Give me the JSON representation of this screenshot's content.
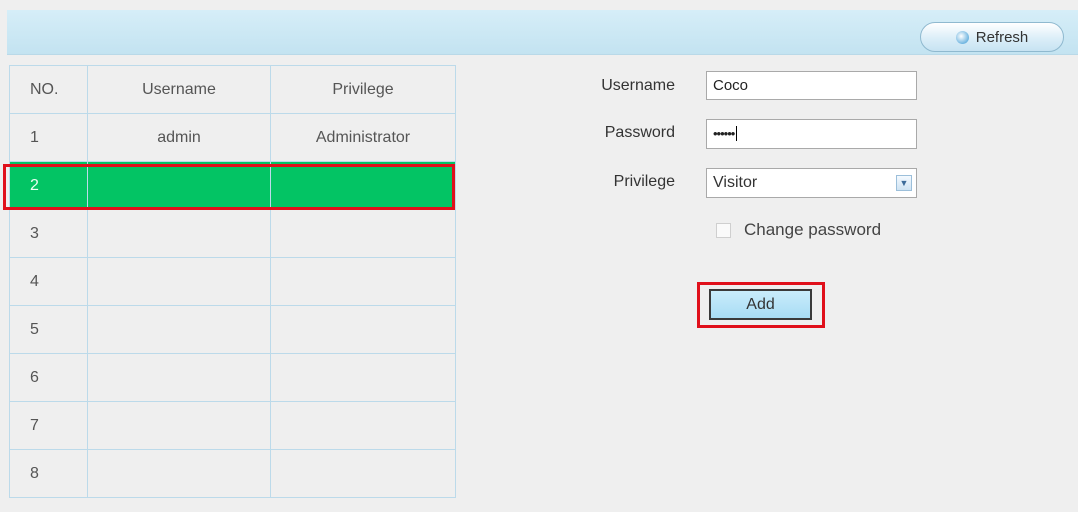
{
  "toolbar": {
    "refresh_label": "Refresh"
  },
  "table": {
    "headers": [
      "NO.",
      "Username",
      "Privilege"
    ],
    "rows": [
      {
        "no": "1",
        "username": "admin",
        "privilege": "Administrator"
      },
      {
        "no": "2",
        "username": "",
        "privilege": ""
      },
      {
        "no": "3",
        "username": "",
        "privilege": ""
      },
      {
        "no": "4",
        "username": "",
        "privilege": ""
      },
      {
        "no": "5",
        "username": "",
        "privilege": ""
      },
      {
        "no": "6",
        "username": "",
        "privilege": ""
      },
      {
        "no": "7",
        "username": "",
        "privilege": ""
      },
      {
        "no": "8",
        "username": "",
        "privilege": ""
      }
    ],
    "selected_row": "2",
    "selected_color": "#03c464"
  },
  "form": {
    "username_label": "Username",
    "username_value": "Coco",
    "password_label": "Password",
    "password_value": "••••••",
    "privilege_label": "Privilege",
    "privilege_value": "Visitor",
    "change_password_label": "Change password",
    "change_password_checked": false,
    "add_label": "Add"
  },
  "colors": {
    "highlight": "#e0101b",
    "header_bar": "#c9e8f5"
  }
}
